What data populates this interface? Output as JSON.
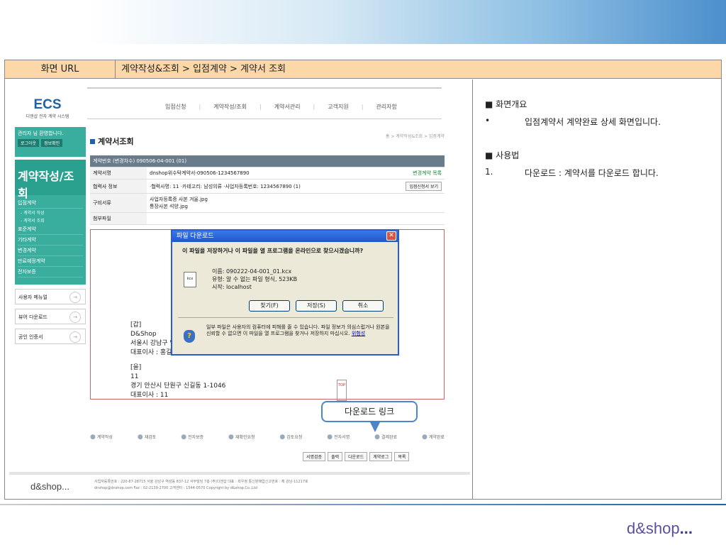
{
  "header": {
    "url_label": "화면 URL",
    "breadcrumb": "계약작성&조회 > 입점계약 > 계약서 조회"
  },
  "description": {
    "section1_title": "■ 화면개요",
    "section1_bullet": "•",
    "section1_text": "입점계약서 계약완료 상세 화면입니다.",
    "section2_title": "■ 사용법",
    "section2_num": "1.",
    "section2_text": "다운로드 : 계약서를 다운로드 합니다."
  },
  "app": {
    "logo": "ECS",
    "logo_sub": "디앤샵 전자 계약 시스템",
    "nav": [
      "입점신청",
      "계약작성/조회",
      "계약서관리",
      "고객지원",
      "관리자함"
    ],
    "login_text": "관리자 님 환영합니다.",
    "logout_btn": "로그아웃",
    "info_btn": "정보확인",
    "side_title": "계약작성/조회",
    "side_menu": [
      "입점계약",
      "- 계약서 작성",
      "- 계약서 조회",
      "표준계약",
      "기타계약",
      "변경계약",
      "만료예정계약",
      "전자보증"
    ],
    "side_links": [
      "사용자 메뉴얼",
      "뷰어 다운로드",
      "공인 인증서"
    ],
    "page_title": "계약서조회",
    "page_bc": "홈 > 계약작성&조회 > 입점계약",
    "contract_no": "계약번호 (변경차수)   090506-04-001 (01)",
    "rows": [
      {
        "label": "계약서명",
        "value": "dnshop위수탁계약서-090506-1234567890",
        "extra": "변경계약 목록"
      },
      {
        "label": "협력사 정보",
        "value": "·협력사명: 11   ·카테고리: 남성의류   ·사업자등록번호: 1234567890 (1)",
        "extra": "입점신청서 보기"
      },
      {
        "label": "구비서류",
        "value": "사업자등록증 사본      겨울.jpg",
        "value2": "통장사본      석양.jpg"
      },
      {
        "label": "첨부파일",
        "value": ""
      }
    ],
    "party_a": [
      "[갑]",
      "D&Shop",
      "서울시 강남구 역삼동",
      "대표이사 : 홍길동"
    ],
    "party_b": [
      "[을]",
      "11",
      "경기 안산시 단원구 신길동 1-1046",
      "대표이사 : 11"
    ],
    "steps": [
      "계약작성",
      "재검토",
      "전자보증",
      "재확인요청",
      "검토요청",
      "전자서명",
      "결제완료",
      "계약완료"
    ],
    "buttons": [
      "서명검증",
      "출력",
      "다운로드",
      "계약로그",
      "목록"
    ],
    "footer_logo": "d&shop...",
    "footer_line1": "사업자등록번호 : 220-87-28715  서울 강남구 역삼동 837-12 서무빌딩 7층 (주)디앤샵  대표 : 최우정  통신판매업신고번호 : 제 강남-11217호",
    "footer_line2": "dnshop@dnshop.com  Fax : 02-2139-2700  고객센터 : 1544-0570  Copyright by d&shop.Co.,Ltd",
    "top_btn": "TOP"
  },
  "dialog": {
    "title": "파일 다운로드",
    "close": "✕",
    "question": "이 파일을 저장하거나 이 파일을 열 프로그램을 온라인으로 찾으시겠습니까?",
    "name": "이름:  090222-04-001_01.kcx",
    "type": "유형:  알 수 없는 파일 형식, 523KB",
    "from": "시작:  localhost",
    "find_btn": "찾기(F)",
    "save_btn": "저장(S)",
    "cancel_btn": "취소",
    "warning": "일부 파일은 사용자의 컴퓨터에 피해를 줄 수 있습니다. 파일 정보가 의심스럽거나 원본을 신뢰할 수 없으면 이 파일을 열 프로그램을 찾거나 저장하지 마십시오.",
    "risk_link": "위험성",
    "file_icon": "kcx"
  },
  "callout": "다운로드 링크",
  "brand": "d&shop"
}
